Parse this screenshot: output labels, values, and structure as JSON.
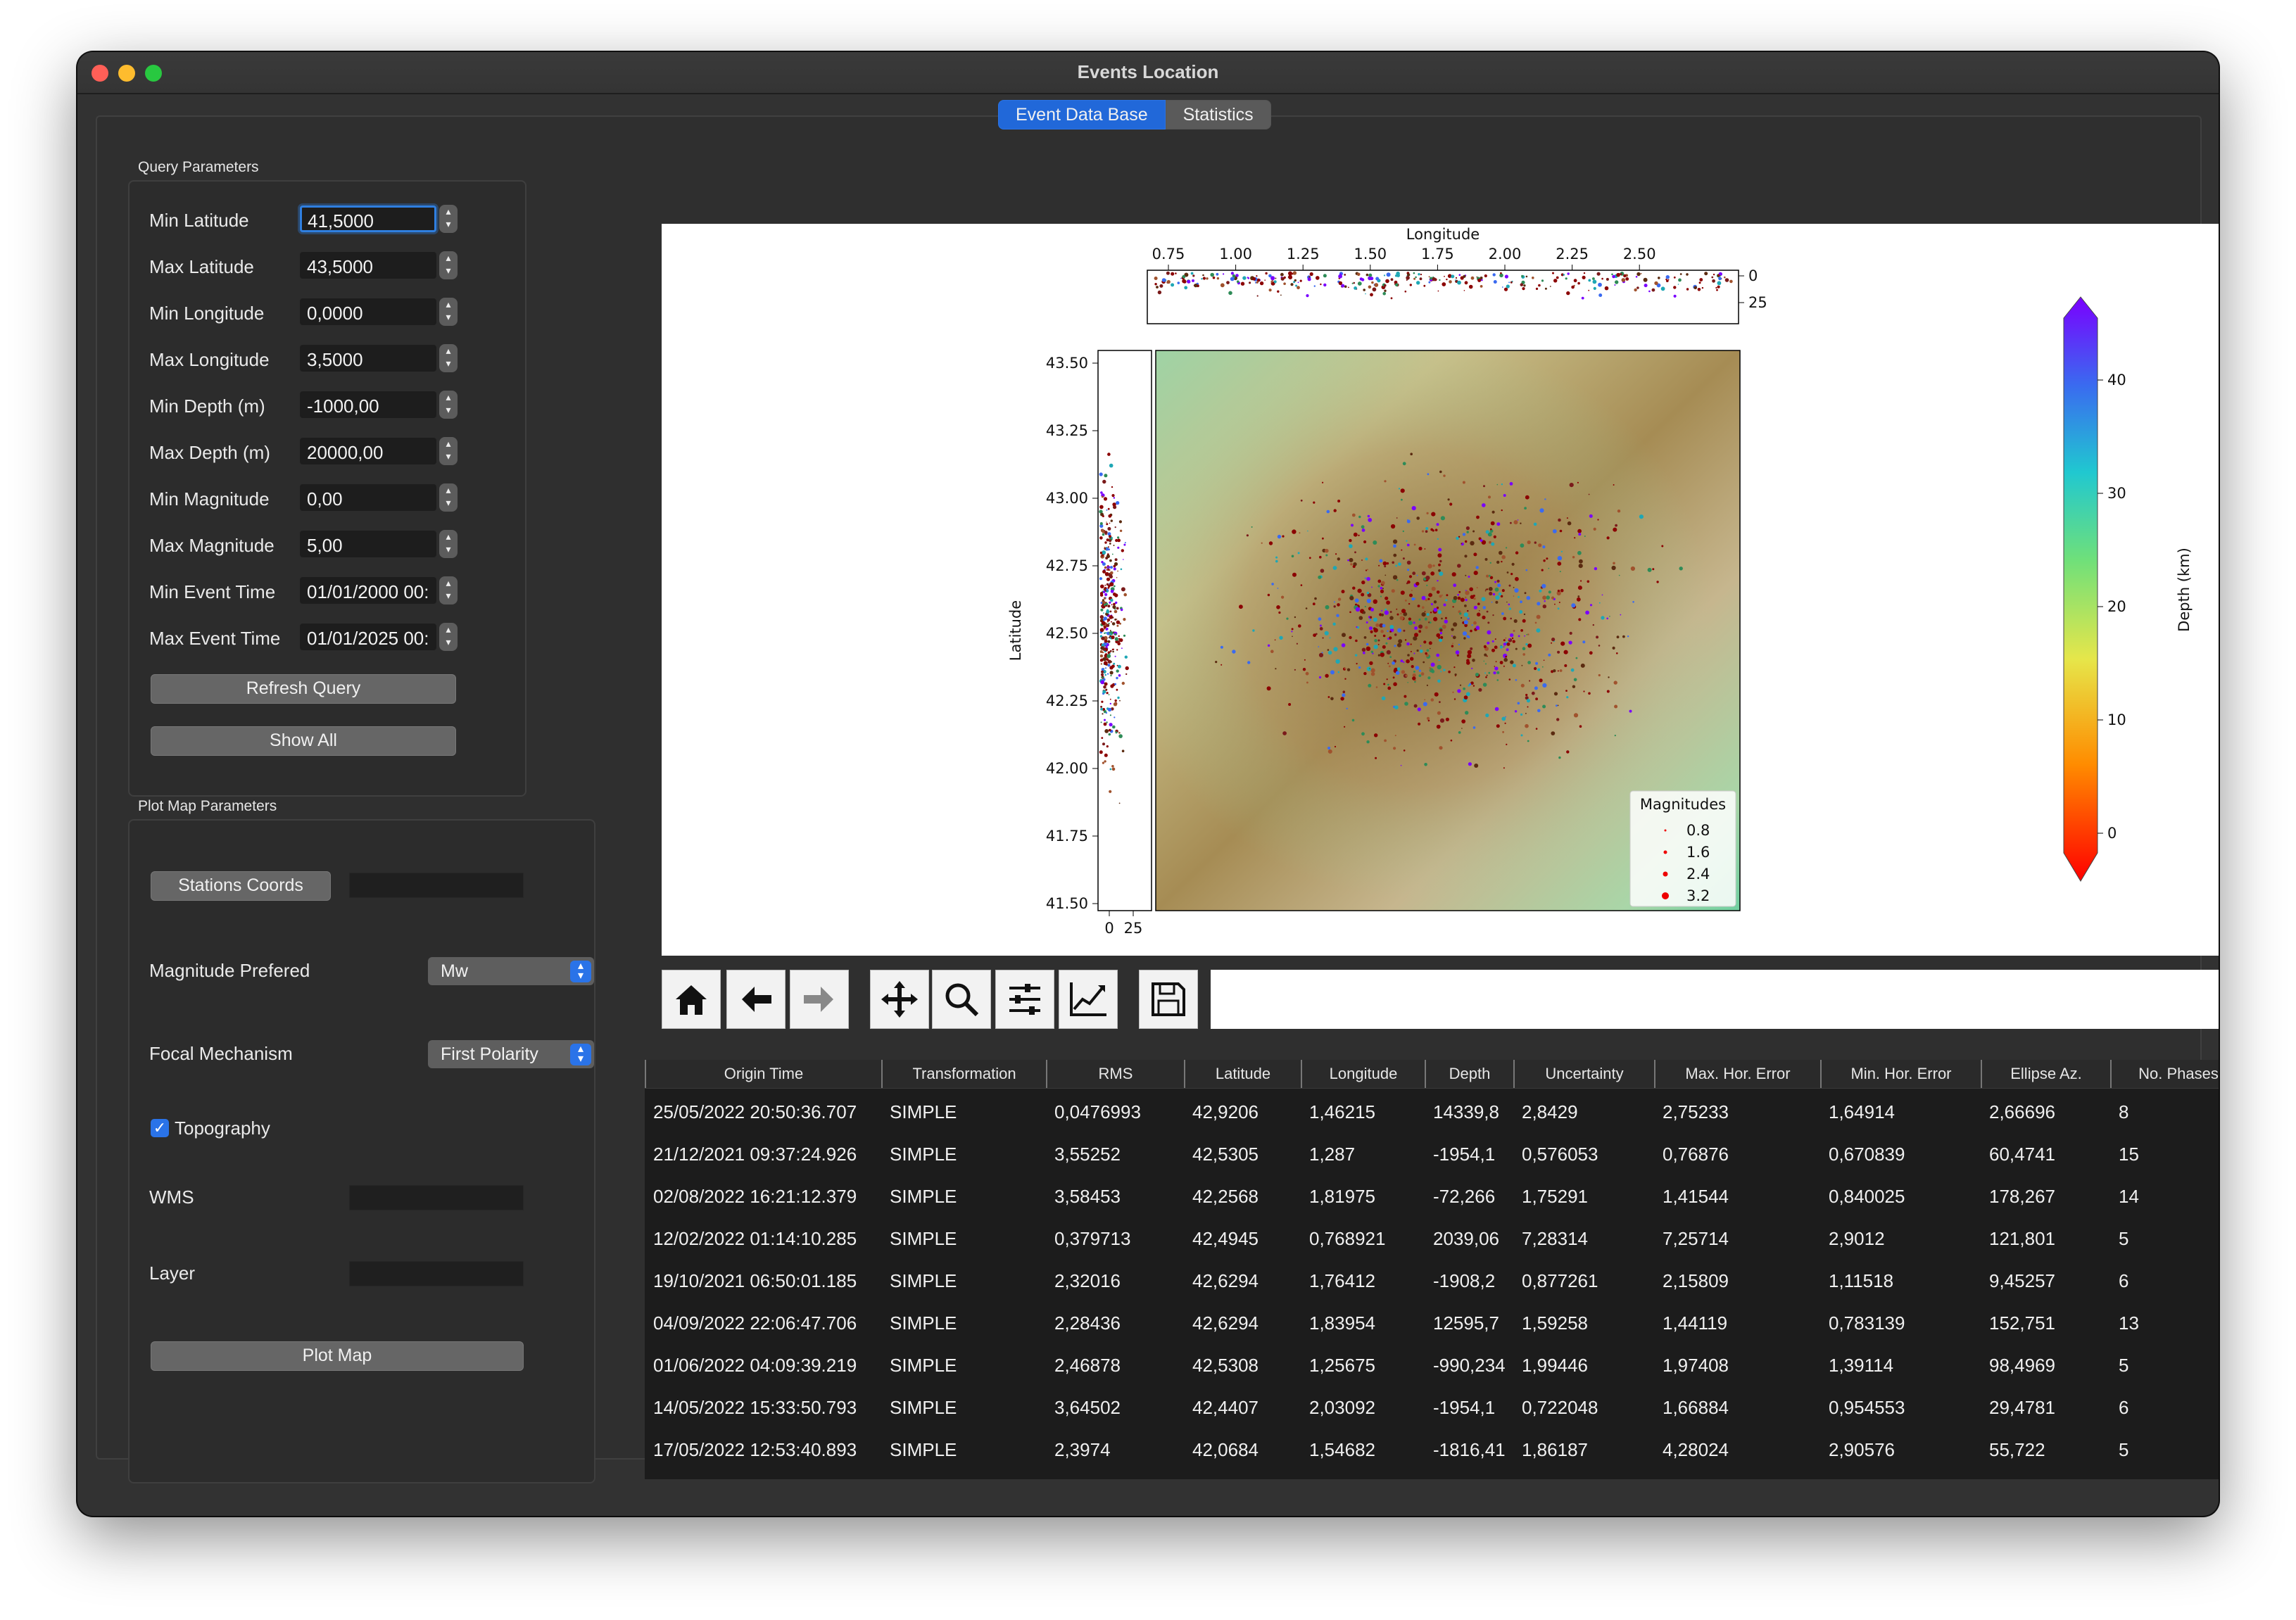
{
  "window": {
    "title": "Events Location"
  },
  "tabs": [
    {
      "label": "Event Data Base",
      "active": true
    },
    {
      "label": "Statistics",
      "active": false
    }
  ],
  "query": {
    "title": "Query Parameters",
    "fields": [
      {
        "label": "Min Latitude",
        "value": "41,5000"
      },
      {
        "label": "Max Latitude",
        "value": "43,5000"
      },
      {
        "label": "Min Longitude",
        "value": "0,0000"
      },
      {
        "label": "Max Longitude",
        "value": "3,5000"
      },
      {
        "label": "Min Depth (m)",
        "value": "-1000,00"
      },
      {
        "label": "Max Depth (m)",
        "value": "20000,00"
      },
      {
        "label": "Min Magnitude",
        "value": "0,00"
      },
      {
        "label": "Max Magnitude",
        "value": "5,00"
      },
      {
        "label": "Min Event Time",
        "value": "01/01/2000 00:"
      },
      {
        "label": "Max Event Time",
        "value": "01/01/2025 00:"
      }
    ],
    "refresh_label": "Refresh Query",
    "show_all_label": "Show All"
  },
  "plot_params": {
    "title": "Plot Map Parameters",
    "stations_label": "Stations Coords",
    "magnitude_label": "Magnitude Prefered",
    "magnitude_value": "Mw",
    "focal_label": "Focal Mechanism",
    "focal_value": "First Polarity",
    "topography_label": "Topography",
    "topography_checked": true,
    "wms_label": "WMS",
    "layer_label": "Layer",
    "plot_label": "Plot Map"
  },
  "map": {
    "x_axis_label": "Longitude",
    "x_ticks": [
      "0.75",
      "1.00",
      "1.25",
      "1.50",
      "1.75",
      "2.00",
      "2.25",
      "2.50"
    ],
    "top_depth_ticks": [
      "0",
      "25"
    ],
    "y_axis_label": "Latitude",
    "y_ticks": [
      "43.50",
      "43.25",
      "43.00",
      "42.75",
      "42.50",
      "42.25",
      "42.00",
      "41.75",
      "41.50"
    ],
    "side_depth_ticks": [
      "0",
      "25"
    ],
    "colorbar_label": "Depth (km)",
    "colorbar_ticks": [
      "40",
      "30",
      "20",
      "10",
      "0"
    ],
    "legend_title": "Magnitudes",
    "legend_items": [
      "0.8",
      "1.6",
      "2.4",
      "3.2"
    ]
  },
  "toolbar": {
    "buttons": [
      "home-icon",
      "back-arrow-icon",
      "forward-arrow-icon",
      "pan-icon",
      "zoom-icon",
      "subplots-icon",
      "axes-edit-icon",
      "save-icon"
    ]
  },
  "table": {
    "columns": [
      "Origin Time",
      "Transformation",
      "RMS",
      "Latitude",
      "Longitude",
      "Depth",
      "Uncertainty",
      "Max. Hor. Error",
      "Min. Hor. Error",
      "Ellipse Az.",
      "No. Phases"
    ],
    "rows": [
      [
        "25/05/2022 20:50:36.707",
        "SIMPLE",
        "0,0476993",
        "42,9206",
        "1,46215",
        "14339,8",
        "2,8429",
        "2,75233",
        "1,64914",
        "2,66696",
        "8"
      ],
      [
        "21/12/2021 09:37:24.926",
        "SIMPLE",
        "3,55252",
        "42,5305",
        "1,287",
        "-1954,1",
        "0,576053",
        "0,76876",
        "0,670839",
        "60,4741",
        "15"
      ],
      [
        "02/08/2022 16:21:12.379",
        "SIMPLE",
        "3,58453",
        "42,2568",
        "1,81975",
        "-72,266",
        "1,75291",
        "1,41544",
        "0,840025",
        "178,267",
        "14"
      ],
      [
        "12/02/2022 01:14:10.285",
        "SIMPLE",
        "0,379713",
        "42,4945",
        "0,768921",
        "2039,06",
        "7,28314",
        "7,25714",
        "2,9012",
        "121,801",
        "5"
      ],
      [
        "19/10/2021 06:50:01.185",
        "SIMPLE",
        "2,32016",
        "42,6294",
        "1,76412",
        "-1908,2",
        "0,877261",
        "2,15809",
        "1,11518",
        "9,45257",
        "6"
      ],
      [
        "04/09/2022 22:06:47.706",
        "SIMPLE",
        "2,28436",
        "42,6294",
        "1,83954",
        "12595,7",
        "1,59258",
        "1,44119",
        "0,783139",
        "152,751",
        "13"
      ],
      [
        "01/06/2022 04:09:39.219",
        "SIMPLE",
        "2,46878",
        "42,5308",
        "1,25675",
        "-990,234",
        "1,99446",
        "1,97408",
        "1,39114",
        "98,4969",
        "5"
      ],
      [
        "14/05/2022 15:33:50.793",
        "SIMPLE",
        "3,64502",
        "42,4407",
        "2,03092",
        "-1954,1",
        "0,722048",
        "1,66884",
        "0,954553",
        "29,4781",
        "6"
      ],
      [
        "17/05/2022 12:53:40.893",
        "SIMPLE",
        "2,3974",
        "42,0684",
        "1,54682",
        "-1816,41",
        "1,86187",
        "4,28024",
        "2,90576",
        "55,722",
        "5"
      ]
    ]
  }
}
